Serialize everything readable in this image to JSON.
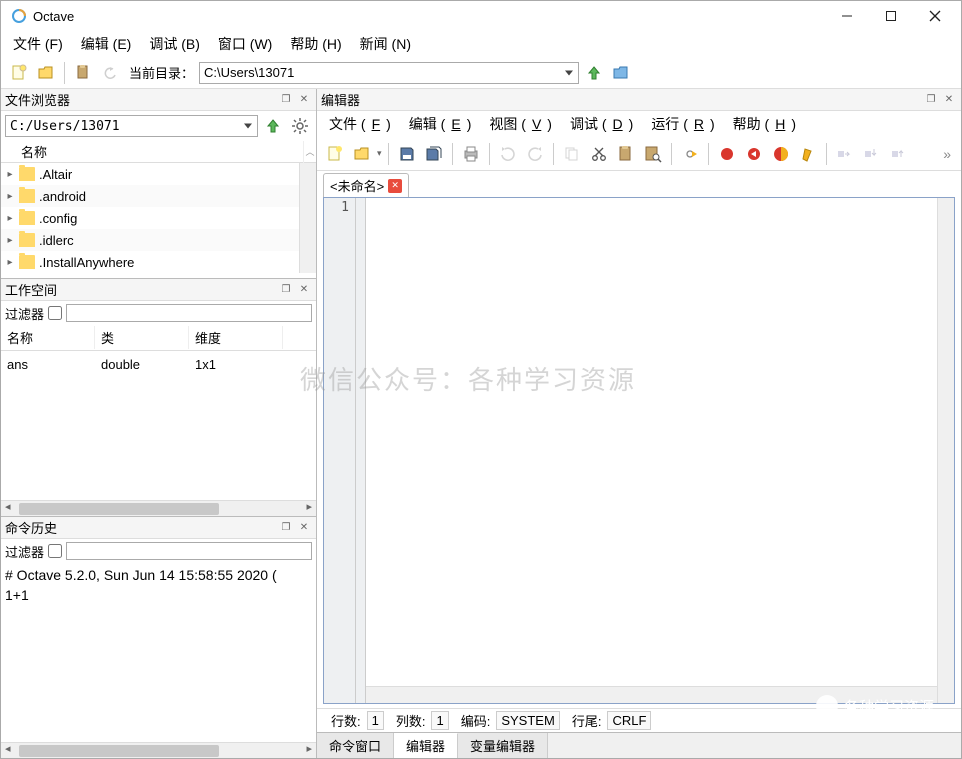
{
  "app": {
    "title": "Octave"
  },
  "menubar": {
    "file": "文件 (F)",
    "edit": "编辑 (E)",
    "debug": "调试 (B)",
    "window": "窗口 (W)",
    "help": "帮助 (H)",
    "news": "新闻 (N)"
  },
  "maintoolbar": {
    "currentdir_label": "当前目录：",
    "currentdir_value": "C:\\Users\\13071"
  },
  "filebrowser": {
    "title": "文件浏览器",
    "path": "C:/Users/13071",
    "col_name": "名称",
    "items": [
      {
        "name": ".Altair"
      },
      {
        "name": ".android"
      },
      {
        "name": ".config"
      },
      {
        "name": ".idlerc"
      },
      {
        "name": ".InstallAnywhere"
      }
    ]
  },
  "workspace": {
    "title": "工作空间",
    "filter_label": "过滤器",
    "cols": {
      "name": "名称",
      "class": "类",
      "dims": "维度"
    },
    "rows": [
      {
        "name": "ans",
        "class": "double",
        "dims": "1x1"
      }
    ]
  },
  "history": {
    "title": "命令历史",
    "filter_label": "过滤器",
    "lines": [
      "# Octave 5.2.0, Sun Jun 14 15:58:55 2020 (",
      "1+1"
    ]
  },
  "editor": {
    "title": "编辑器",
    "menubar": {
      "file": "文件 (F)",
      "edit": "编辑 (E)",
      "view": "视图 (V)",
      "debug": "调试 (D)",
      "run": "运行 (R)",
      "help": "帮助 (H)"
    },
    "tab": {
      "label": "<未命名>"
    },
    "line1": "1",
    "status": {
      "row_label": "行数:",
      "row_val": "1",
      "col_label": "列数:",
      "col_val": "1",
      "enc_label": "编码:",
      "enc_val": "SYSTEM",
      "eol_label": "行尾:",
      "eol_val": "CRLF"
    }
  },
  "bottom_tabs": {
    "cmd": "命令窗口",
    "editor": "编辑器",
    "var": "变量编辑器"
  },
  "watermark": "微信公众号：各种学习资源",
  "watermark2": "各种学习资源"
}
